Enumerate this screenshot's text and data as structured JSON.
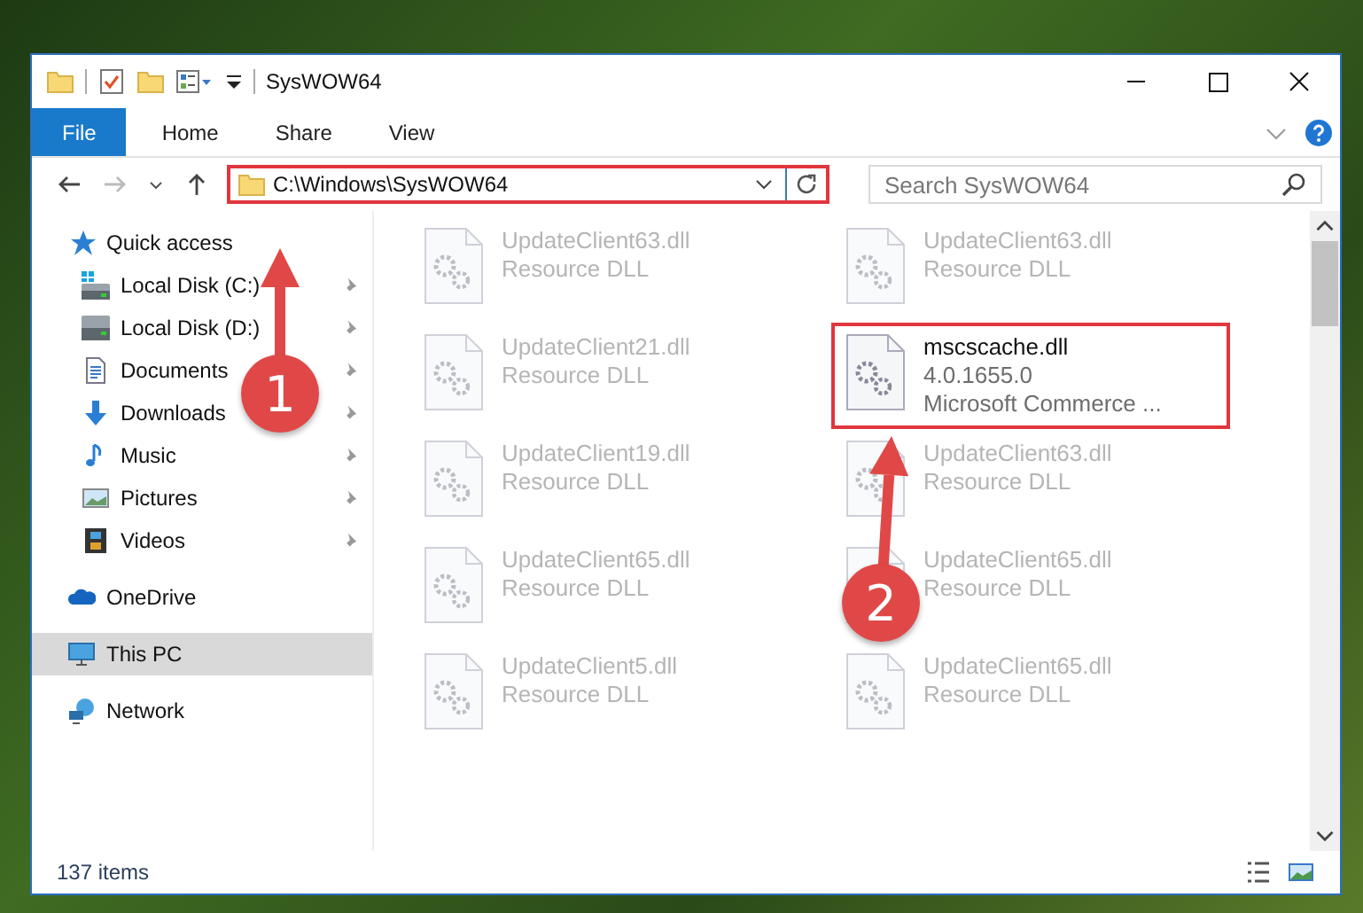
{
  "window": {
    "title": "SysWOW64"
  },
  "ribbon_tabs": [
    {
      "label": "File",
      "kind": "file",
      "selected": false
    },
    {
      "label": "Home",
      "kind": "tab",
      "selected": false
    },
    {
      "label": "Share",
      "kind": "tab",
      "selected": false
    },
    {
      "label": "View",
      "kind": "tab",
      "selected": false
    }
  ],
  "address": {
    "path": "C:\\Windows\\SysWOW64",
    "highlighted": true
  },
  "search": {
    "placeholder": "Search SysWOW64"
  },
  "sidebar": {
    "items": [
      {
        "label": "Quick access",
        "kind": "star",
        "selected": false,
        "children": [
          {
            "label": "Local Disk (C:)",
            "kind": "drive-c",
            "pinned": true,
            "selected": false
          },
          {
            "label": "Local Disk (D:)",
            "kind": "drive",
            "pinned": true,
            "selected": false
          },
          {
            "label": "Documents",
            "kind": "documents",
            "pinned": true,
            "selected": false
          },
          {
            "label": "Downloads",
            "kind": "downloads",
            "pinned": true,
            "selected": false
          },
          {
            "label": "Music",
            "kind": "music",
            "pinned": true,
            "selected": false
          },
          {
            "label": "Pictures",
            "kind": "pictures",
            "pinned": true,
            "selected": false
          },
          {
            "label": "Videos",
            "kind": "videos",
            "pinned": true,
            "selected": false
          }
        ]
      },
      {
        "label": "OneDrive",
        "kind": "cloud",
        "selected": false
      },
      {
        "label": "This PC",
        "kind": "pc",
        "selected": true
      },
      {
        "label": "Network",
        "kind": "network",
        "selected": false
      }
    ]
  },
  "files": [
    {
      "name": "UpdateClient63.dll",
      "details": [
        "Resource DLL"
      ],
      "blurred": true,
      "highlighted": false
    },
    {
      "name": "UpdateClient63.dll",
      "details": [
        "Resource DLL"
      ],
      "blurred": true,
      "highlighted": false
    },
    {
      "name": "UpdateClient21.dll",
      "details": [
        "Resource DLL"
      ],
      "blurred": true,
      "highlighted": false
    },
    {
      "name": "mscscache.dll",
      "details": [
        "4.0.1655.0",
        "Microsoft Commerce ..."
      ],
      "blurred": false,
      "highlighted": true
    },
    {
      "name": "UpdateClient19.dll",
      "details": [
        "Resource DLL"
      ],
      "blurred": true,
      "highlighted": false
    },
    {
      "name": "UpdateClient63.dll",
      "details": [
        "Resource DLL"
      ],
      "blurred": true,
      "highlighted": false
    },
    {
      "name": "UpdateClient65.dll",
      "details": [
        "Resource DLL"
      ],
      "blurred": true,
      "highlighted": false
    },
    {
      "name": "UpdateClient65.dll",
      "details": [
        "Resource DLL"
      ],
      "blurred": true,
      "highlighted": false
    },
    {
      "name": "UpdateClient5.dll",
      "details": [
        "Resource DLL"
      ],
      "blurred": true,
      "highlighted": false
    },
    {
      "name": "UpdateClient65.dll",
      "details": [
        "Resource DLL"
      ],
      "blurred": true,
      "highlighted": false
    }
  ],
  "status_bar": {
    "count": "137 items"
  },
  "annotations": [
    {
      "number": "1"
    },
    {
      "number": "2"
    }
  ]
}
